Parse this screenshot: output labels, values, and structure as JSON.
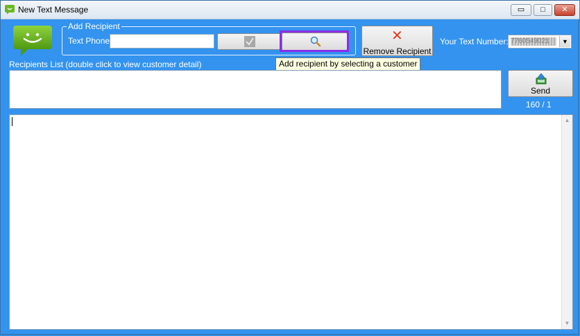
{
  "window": {
    "title": "New Text Message",
    "controls": {
      "minimize": "▭",
      "maximize": "□",
      "close": "✕"
    }
  },
  "add_recipient": {
    "group_title": "Add Recipient",
    "text_phone_label": "Text Phone:",
    "text_phone_value": "",
    "confirm_icon": "check-icon",
    "search_icon": "magnifier-icon",
    "tooltip": "Add recipient by selecting a customer"
  },
  "remove_recipient": {
    "label": "Remove Recipient",
    "icon": "x-icon"
  },
  "your_number": {
    "label": "Your Text Number:",
    "value": "7760549021"
  },
  "recipients": {
    "label": "Recipients List (double click to view customer detail)"
  },
  "send": {
    "label": "Send",
    "icon": "send-icon"
  },
  "counter": "160 / 1",
  "message": {
    "value": ""
  },
  "colors": {
    "client_bg": "#3393ef",
    "highlight": "#8b2ee6",
    "remove_x": "#e03a1e"
  }
}
